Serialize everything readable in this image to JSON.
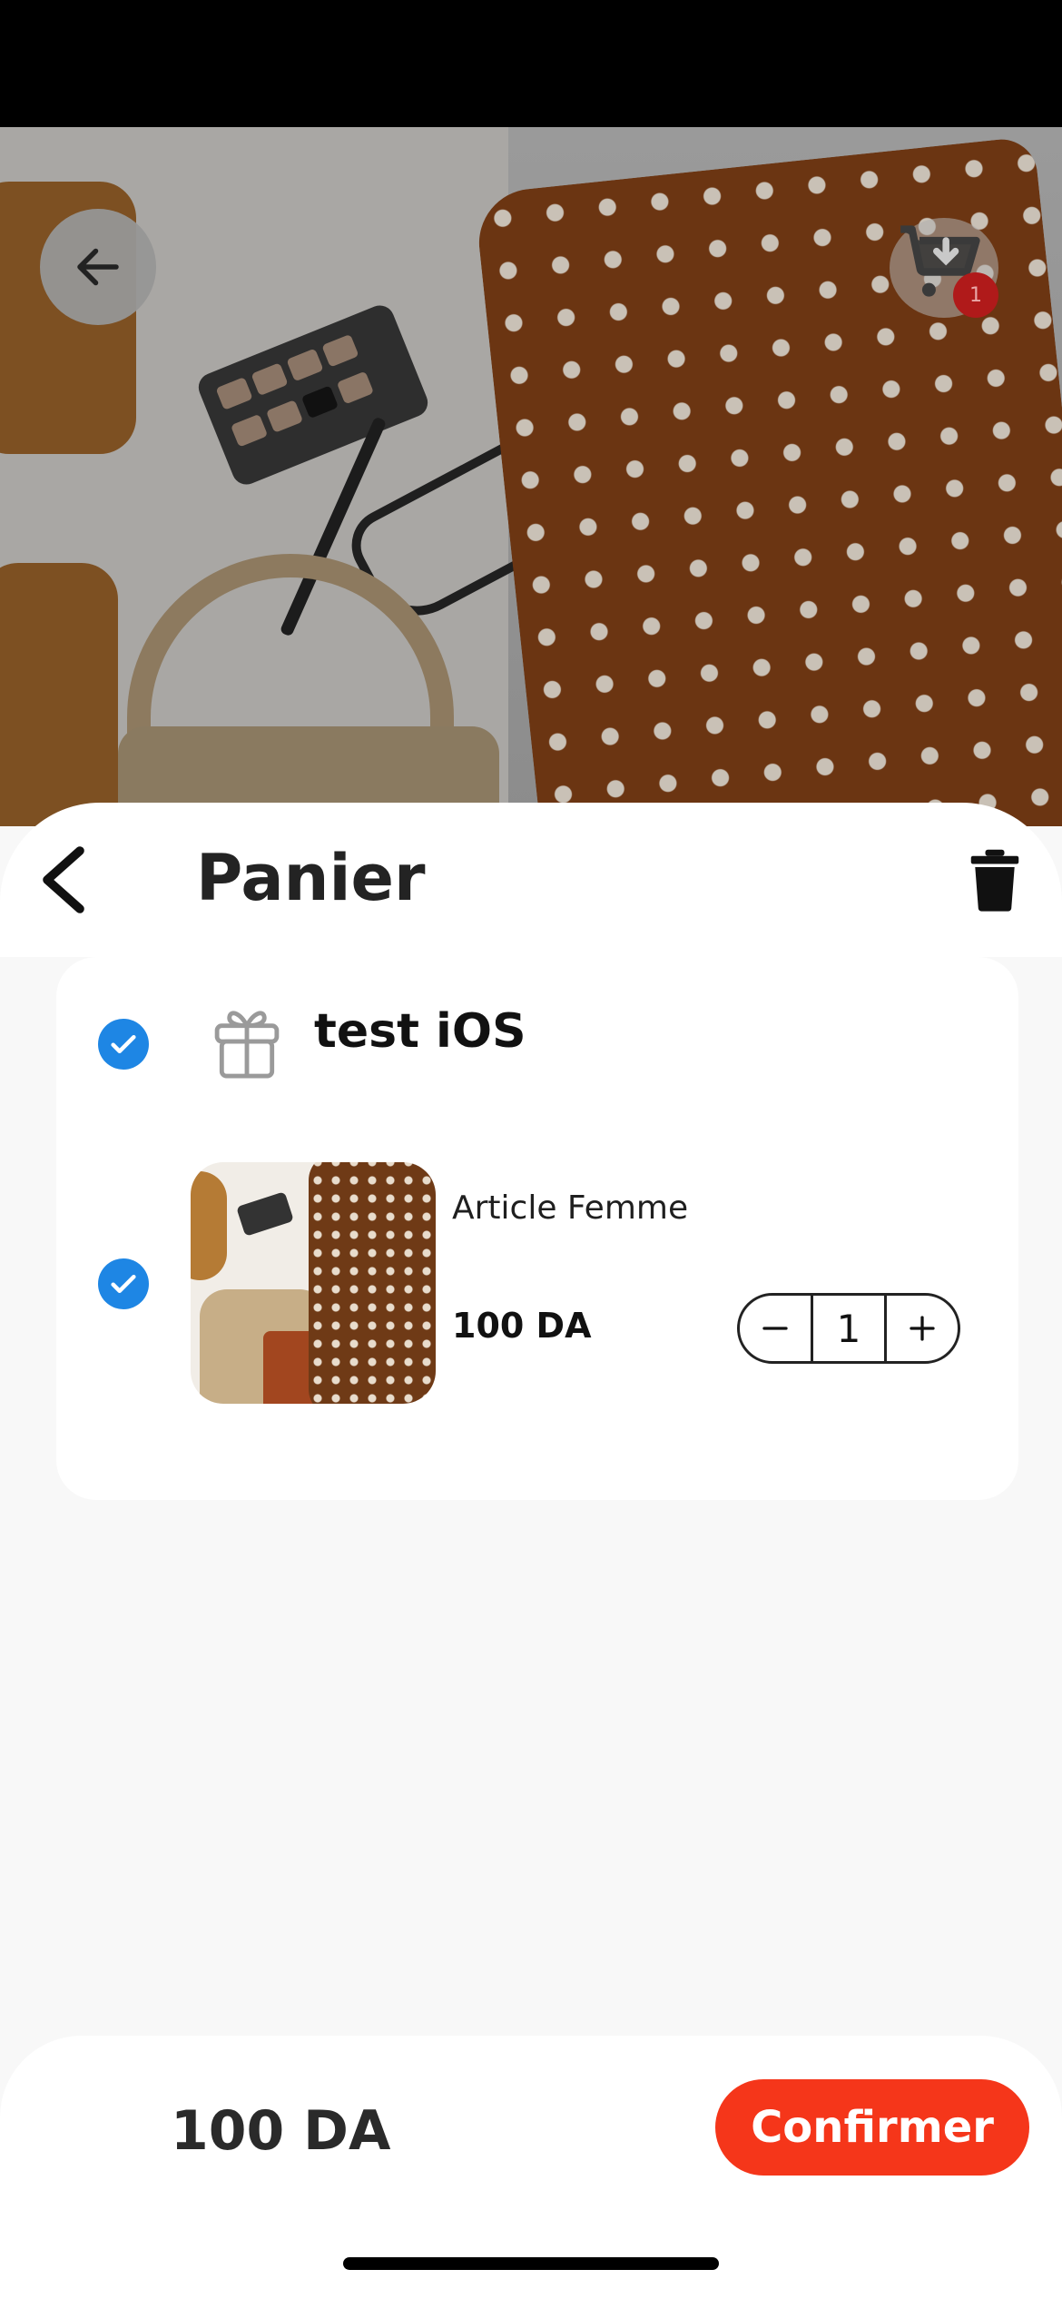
{
  "hero": {
    "cart_badge_count": "1",
    "icons": {
      "back": "arrow-left-icon",
      "cart": "cart-download-icon"
    }
  },
  "header": {
    "title": "Panier",
    "icons": {
      "back": "chevron-left-icon",
      "delete": "trash-icon"
    }
  },
  "cart": {
    "shop": {
      "name": "test iOS",
      "selected": true,
      "icon": "gift-icon"
    },
    "items": [
      {
        "name": "Article Femme",
        "price": "100 DA",
        "quantity": "1",
        "selected": true
      }
    ]
  },
  "footer": {
    "total": "100 DA",
    "confirm_label": "Confirmer"
  },
  "colors": {
    "accent": "#f5361a",
    "checkbox": "#1e86e4",
    "badge": "#b01a1a"
  }
}
